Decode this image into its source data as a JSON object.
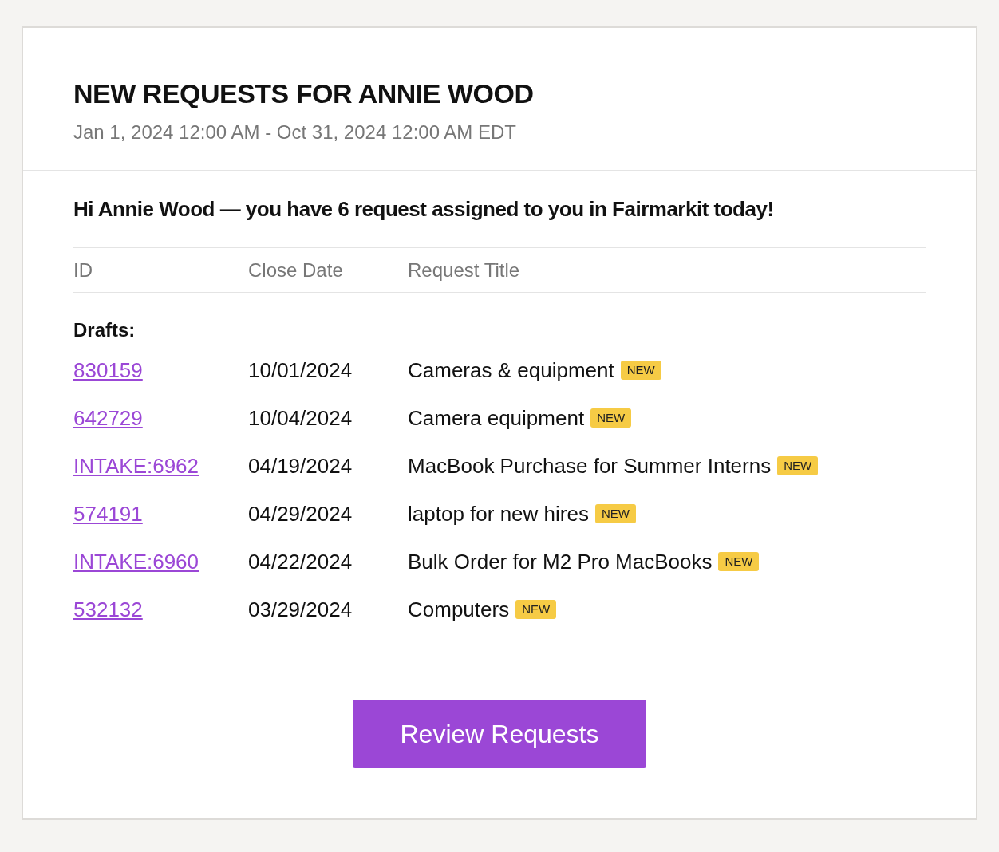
{
  "header": {
    "title": "NEW REQUESTS FOR ANNIE WOOD",
    "date_range": "Jan 1, 2024 12:00 AM - Oct 31, 2024 12:00 AM EDT"
  },
  "greeting": "Hi Annie Wood — you have 6 request assigned to you in Fairmarkit today!",
  "table": {
    "columns": [
      "ID",
      "Close Date",
      "Request Title"
    ],
    "groups": [
      {
        "label": "Drafts:",
        "rows": [
          {
            "id": "830159",
            "close_date": "10/01/2024",
            "title": "Cameras & equipment",
            "badge": "NEW"
          },
          {
            "id": "642729",
            "close_date": "10/04/2024",
            "title": "Camera equipment",
            "badge": "NEW"
          },
          {
            "id": "INTAKE:6962",
            "close_date": "04/19/2024",
            "title": "MacBook Purchase for Summer Interns",
            "badge": "NEW"
          },
          {
            "id": "574191",
            "close_date": "04/29/2024",
            "title": "laptop for new hires",
            "badge": "NEW"
          },
          {
            "id": "INTAKE:6960",
            "close_date": "04/22/2024",
            "title": "Bulk Order for M2 Pro MacBooks",
            "badge": "NEW"
          },
          {
            "id": "532132",
            "close_date": "03/29/2024",
            "title": "Computers",
            "badge": "NEW"
          }
        ]
      }
    ]
  },
  "button": "Review Requests"
}
